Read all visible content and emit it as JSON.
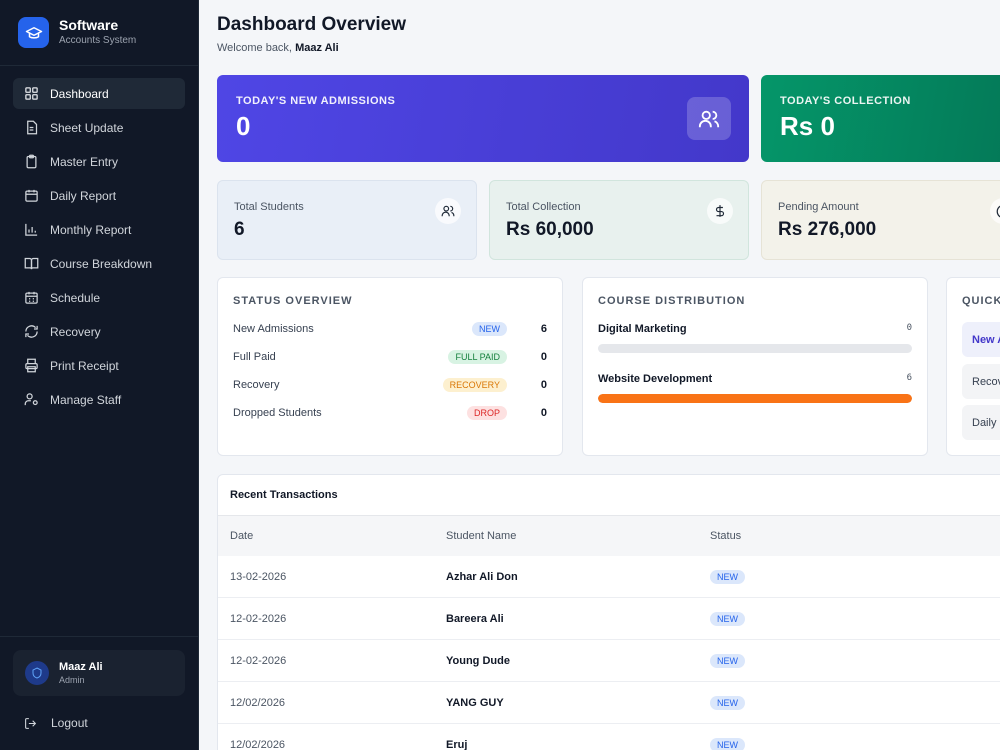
{
  "brand": {
    "title": "Software",
    "subtitle": "Accounts System"
  },
  "nav": [
    {
      "label": "Dashboard",
      "icon": "grid-icon",
      "active": true
    },
    {
      "label": "Sheet Update",
      "icon": "sheet-icon"
    },
    {
      "label": "Master Entry",
      "icon": "clipboard-icon"
    },
    {
      "label": "Daily Report",
      "icon": "calendar-icon"
    },
    {
      "label": "Monthly Report",
      "icon": "bar-chart-icon"
    },
    {
      "label": "Course Breakdown",
      "icon": "book-icon"
    },
    {
      "label": "Schedule",
      "icon": "calendar-grid-icon"
    },
    {
      "label": "Recovery",
      "icon": "refresh-icon"
    },
    {
      "label": "Print Receipt",
      "icon": "printer-icon"
    },
    {
      "label": "Manage Staff",
      "icon": "user-gear-icon"
    }
  ],
  "user": {
    "name": "Maaz Ali",
    "role": "Admin"
  },
  "logout_label": "Logout",
  "header": {
    "title": "Dashboard Overview",
    "welcome_prefix": "Welcome back,",
    "welcome_name": "Maaz Ali"
  },
  "hero": {
    "admissions": {
      "label": "TODAY'S NEW ADMISSIONS",
      "value": "0"
    },
    "collection": {
      "label": "TODAY'S COLLECTION",
      "value": "Rs 0"
    }
  },
  "stats": {
    "students": {
      "label": "Total Students",
      "value": "6"
    },
    "collection": {
      "label": "Total Collection",
      "value": "Rs 60,000"
    },
    "pending": {
      "label": "Pending Amount",
      "value": "Rs 276,000"
    }
  },
  "status_overview": {
    "title": "STATUS OVERVIEW",
    "rows": [
      {
        "label": "New Admissions",
        "badge": "NEW",
        "count": "6"
      },
      {
        "label": "Full Paid",
        "badge": "FULL PAID",
        "count": "0"
      },
      {
        "label": "Recovery",
        "badge": "RECOVERY",
        "count": "0"
      },
      {
        "label": "Dropped Students",
        "badge": "DROP",
        "count": "0"
      }
    ]
  },
  "course_distribution": {
    "title": "COURSE DISTRIBUTION",
    "courses": [
      {
        "name": "Digital Marketing",
        "count": "0",
        "fraction": 0
      },
      {
        "name": "Website Development",
        "count": "6",
        "fraction": 1
      }
    ]
  },
  "quick": {
    "title": "QUICK",
    "items": [
      "New A",
      "Recov",
      "Daily"
    ]
  },
  "transactions": {
    "title": "Recent Transactions",
    "columns": [
      "Date",
      "Student Name",
      "Status"
    ],
    "rows": [
      {
        "date": "13-02-2026",
        "name": "Azhar Ali Don",
        "status": "NEW"
      },
      {
        "date": "12-02-2026",
        "name": "Bareera Ali",
        "status": "NEW"
      },
      {
        "date": "12-02-2026",
        "name": "Young Dude",
        "status": "NEW"
      },
      {
        "date": "12/02/2026",
        "name": "YANG GUY",
        "status": "NEW"
      },
      {
        "date": "12/02/2026",
        "name": "Eruj",
        "status": "NEW"
      }
    ]
  }
}
